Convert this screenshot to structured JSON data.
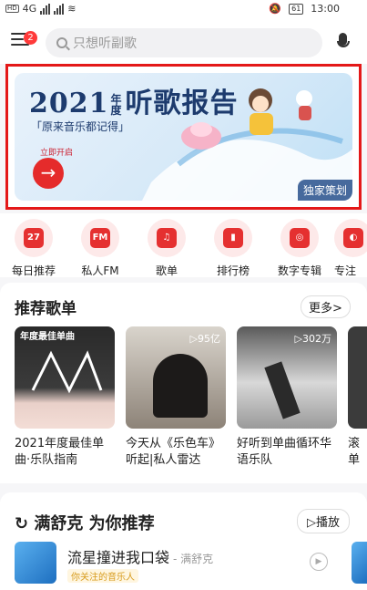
{
  "status_bar": {
    "network": "4G",
    "battery": "61",
    "time": "13:00"
  },
  "header": {
    "notification_count": "2",
    "search_placeholder": "只想听副歌"
  },
  "banner": {
    "title_year": "2021",
    "title_small": "年度",
    "title_main": "听歌报告",
    "subtitle": "「原来音乐都记得」",
    "start_label": "立即开启",
    "go_arrow": "→",
    "tag": "独家策划"
  },
  "quick_icons": [
    {
      "label": "每日推荐",
      "icon": "calendar-icon",
      "glyph": "27"
    },
    {
      "label": "私人FM",
      "icon": "radio-icon",
      "glyph": "FM"
    },
    {
      "label": "歌单",
      "icon": "playlist-icon",
      "glyph": "♫"
    },
    {
      "label": "排行榜",
      "icon": "chart-icon",
      "glyph": "▮"
    },
    {
      "label": "数字专辑",
      "icon": "album-icon",
      "glyph": "◎"
    },
    {
      "label": "专注",
      "icon": "focus-icon",
      "glyph": "◐"
    }
  ],
  "playlists": {
    "title": "推荐歌单",
    "more_label": "更多>",
    "items": [
      {
        "title": "2021年度最佳单曲·乐队指南",
        "count": "",
        "cover_text": "年度最佳单曲"
      },
      {
        "title": "今天从《乐色车》听起|私人雷达",
        "count": "▷95亿",
        "cover_text": ""
      },
      {
        "title": "好听到单曲循环华语乐队",
        "count": "▷302万",
        "cover_text": ""
      },
      {
        "title": "滚单",
        "count": "",
        "cover_text": ""
      }
    ]
  },
  "recommend": {
    "title": "满舒克 为你推荐",
    "refresh_icon": "refresh-icon",
    "play_label": "▷播放",
    "song": {
      "title": "流星撞进我口袋",
      "artist": "- 满舒克",
      "tag": "你关注的音乐人"
    }
  },
  "colors": {
    "accent": "#e53030",
    "banner_border": "#e41818"
  }
}
